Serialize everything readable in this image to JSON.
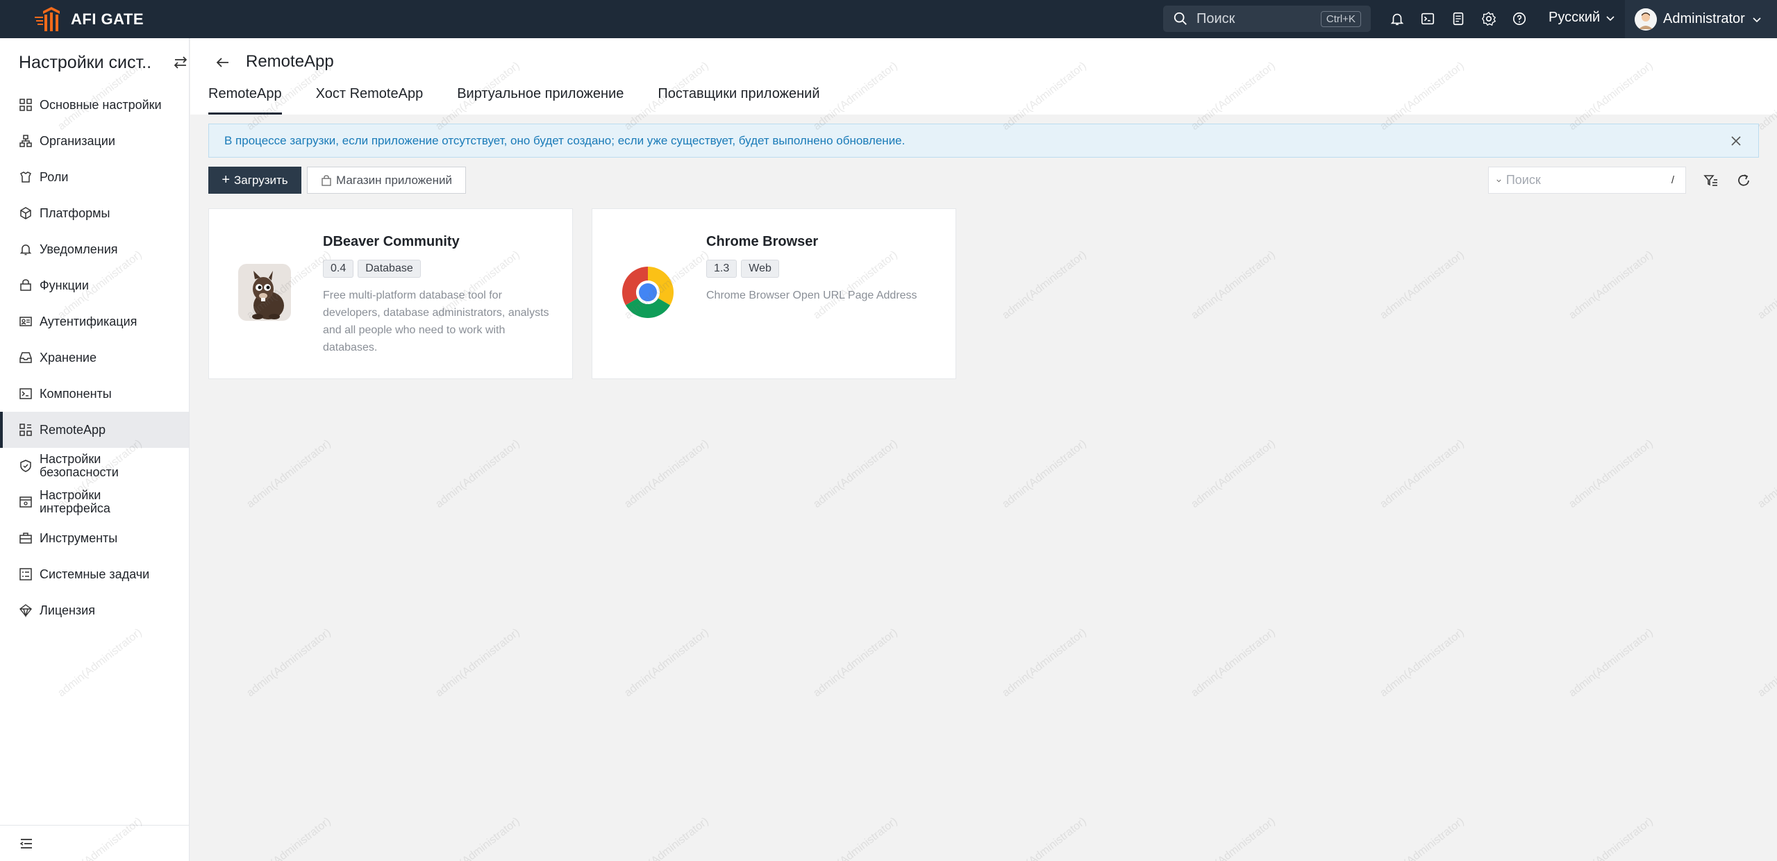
{
  "brand": {
    "name": "AFI GATE"
  },
  "topbar": {
    "search_placeholder": "Поиск",
    "search_shortcut": "Ctrl+K",
    "icons": [
      "bell-icon",
      "terminal-icon",
      "clipboard-icon",
      "gear-icon",
      "help-icon"
    ],
    "language": "Русский",
    "user_name": "Administrator"
  },
  "sidebar": {
    "title": "Настройки сист...",
    "items": [
      {
        "label": "Основные настройки",
        "icon": "grid-icon"
      },
      {
        "label": "Организации",
        "icon": "org-icon"
      },
      {
        "label": "Роли",
        "icon": "role-icon"
      },
      {
        "label": "Платформы",
        "icon": "cube-icon"
      },
      {
        "label": "Уведомления",
        "icon": "bell-icon"
      },
      {
        "label": "Функции",
        "icon": "function-icon"
      },
      {
        "label": "Аутентификация",
        "icon": "id-card-icon"
      },
      {
        "label": "Хранение",
        "icon": "inbox-icon"
      },
      {
        "label": "Компоненты",
        "icon": "terminal-icon"
      },
      {
        "label": "RemoteApp",
        "icon": "apps-icon",
        "active": true
      },
      {
        "label": "Настройки безопасности",
        "icon": "shield-icon"
      },
      {
        "label": "Настройки интерфейса",
        "icon": "interface-icon"
      },
      {
        "label": "Инструменты",
        "icon": "toolbox-icon"
      },
      {
        "label": "Системные задачи",
        "icon": "tasks-icon"
      },
      {
        "label": "Лицензия",
        "icon": "license-icon"
      }
    ]
  },
  "page": {
    "title": "RemoteApp",
    "tabs": [
      {
        "label": "RemoteApp",
        "active": true
      },
      {
        "label": "Хост RemoteApp"
      },
      {
        "label": "Виртуальное приложение"
      },
      {
        "label": "Поставщики приложений"
      }
    ]
  },
  "alert": {
    "text": "В процессе загрузки, если приложение отсутствует, оно будет создано; если уже существует, будет выполнено обновление."
  },
  "toolbar": {
    "upload_label": "Загрузить",
    "store_label": "Магазин приложений",
    "search_placeholder": "Поиск",
    "search_shortcut": "/"
  },
  "apps": [
    {
      "name": "DBeaver Community",
      "version": "0.4",
      "category": "Database",
      "description": "Free multi-platform database tool for developers, database administrators, analysts and all people who need to work with databases.",
      "icon": "dbeaver-icon"
    },
    {
      "name": "Chrome Browser",
      "version": "1.3",
      "category": "Web",
      "description": "Chrome Browser Open URL Page Address",
      "icon": "chrome-icon"
    }
  ],
  "watermark": "admin(Administrator)",
  "colors": {
    "topbar": "#1e2a38",
    "primary": "#2b3a4a",
    "alert_bg": "#e6f2f9",
    "alert_text": "#1a7bb8"
  }
}
